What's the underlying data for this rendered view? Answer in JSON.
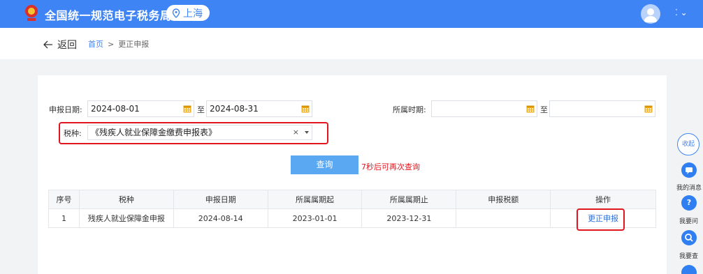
{
  "header": {
    "title": "全国统一规范电子税务局",
    "city": "上海",
    "avatar_icon": "user-avatar-icon",
    "menu_icon": "dots-chevron-icon"
  },
  "breadcrumb": {
    "back_label": "返回",
    "home": "首页",
    "separator": ">",
    "current": "更正申报"
  },
  "form": {
    "declare_date_label": "申报日期:",
    "declare_start": "2024-08-01",
    "to_label": "至",
    "declare_end": "2024-08-31",
    "period_label": "所属时期:",
    "period_start": "",
    "period_end": "",
    "tax_type_label": "税种:",
    "tax_type_value": "《残疾人就业保障金缴费申报表》",
    "clear_icon": "×",
    "query_label": "查询",
    "cooldown_text": "7秒后可再次查询"
  },
  "table": {
    "headers": [
      "序号",
      "税种",
      "申报日期",
      "所属属期起",
      "所属属期止",
      "申报税额",
      "操作"
    ],
    "rows": [
      [
        "1",
        "残疾人就业保障金申报",
        "2024-08-14",
        "2023-01-01",
        "2023-12-31",
        "",
        "更正申报"
      ]
    ]
  },
  "rail": {
    "collapse": "收起",
    "messages": "我的消息",
    "ask": "我要问",
    "search": "我要查"
  },
  "colors": {
    "brand": "#3f84f5",
    "highlight": "#e0161e",
    "button": "#5aa8f1",
    "link": "#2c6fd4"
  }
}
